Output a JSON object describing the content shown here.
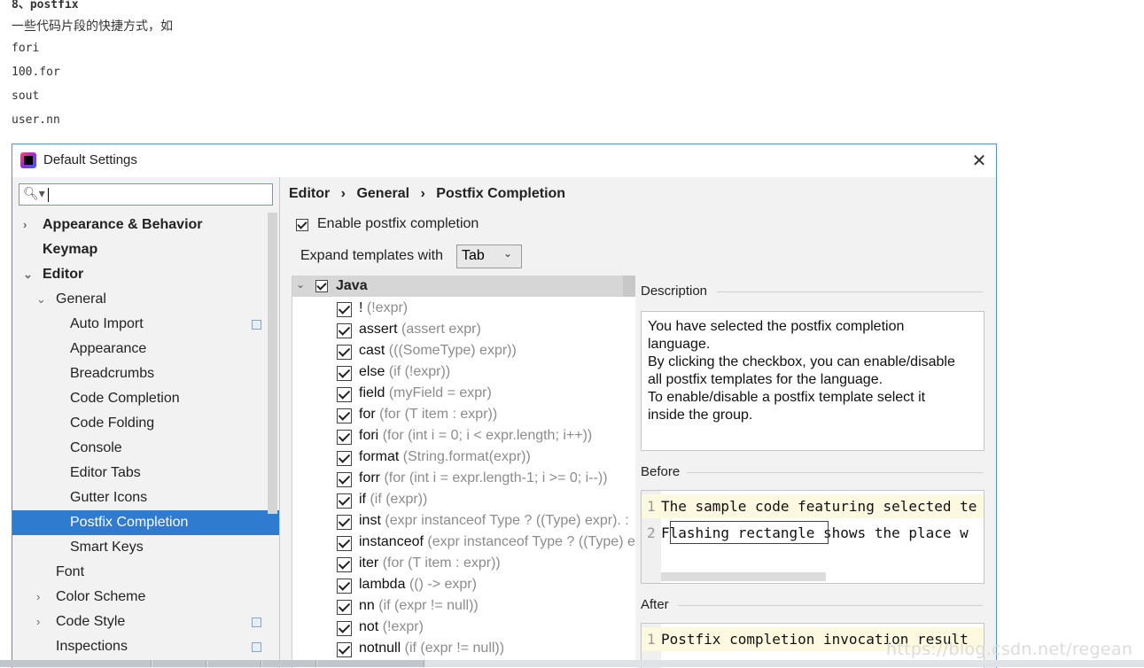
{
  "blog": {
    "heading": "8、postfix",
    "line1": "一些代码片段的快捷方式，如",
    "line2": "fori",
    "line3": "100.for",
    "line4": "sout",
    "line5": "user.nn"
  },
  "window": {
    "title": "Default Settings",
    "close_icon": "close-icon"
  },
  "sidebar": {
    "search_value": "",
    "items": [
      {
        "label": "Appearance & Behavior",
        "level": 0,
        "bold": true,
        "arrow": "›"
      },
      {
        "label": "Keymap",
        "level": 0,
        "bold": true,
        "arrow": ""
      },
      {
        "label": "Editor",
        "level": 0,
        "bold": true,
        "arrow": "⌄"
      },
      {
        "label": "General",
        "level": 1,
        "bold": false,
        "arrow": "⌄"
      },
      {
        "label": "Auto Import",
        "level": 2,
        "bold": false,
        "arrow": "",
        "cfg": true
      },
      {
        "label": "Appearance",
        "level": 2,
        "bold": false,
        "arrow": ""
      },
      {
        "label": "Breadcrumbs",
        "level": 2,
        "bold": false,
        "arrow": ""
      },
      {
        "label": "Code Completion",
        "level": 2,
        "bold": false,
        "arrow": ""
      },
      {
        "label": "Code Folding",
        "level": 2,
        "bold": false,
        "arrow": ""
      },
      {
        "label": "Console",
        "level": 2,
        "bold": false,
        "arrow": ""
      },
      {
        "label": "Editor Tabs",
        "level": 2,
        "bold": false,
        "arrow": ""
      },
      {
        "label": "Gutter Icons",
        "level": 2,
        "bold": false,
        "arrow": ""
      },
      {
        "label": "Postfix Completion",
        "level": 2,
        "bold": false,
        "arrow": "",
        "selected": true
      },
      {
        "label": "Smart Keys",
        "level": 2,
        "bold": false,
        "arrow": ""
      },
      {
        "label": "Font",
        "level": 1,
        "bold": false,
        "arrow": ""
      },
      {
        "label": "Color Scheme",
        "level": 1,
        "bold": false,
        "arrow": "›"
      },
      {
        "label": "Code Style",
        "level": 1,
        "bold": false,
        "arrow": "›",
        "cfg": true
      },
      {
        "label": "Inspections",
        "level": 1,
        "bold": false,
        "arrow": "",
        "cfg": true
      }
    ]
  },
  "breadcrumb": {
    "a": "Editor",
    "sep1": "›",
    "b": "General",
    "sep2": "›",
    "c": "Postfix Completion"
  },
  "options": {
    "enable_label": "Enable postfix completion",
    "expand_label": "Expand templates with",
    "expand_value": "Tab"
  },
  "templates": {
    "group": "Java",
    "items": [
      {
        "key": "!",
        "expr": "(!expr)"
      },
      {
        "key": "assert",
        "expr": "(assert expr)"
      },
      {
        "key": "cast",
        "expr": "(((SomeType) expr))"
      },
      {
        "key": "else",
        "expr": "(if (!expr))"
      },
      {
        "key": "field",
        "expr": "(myField = expr)"
      },
      {
        "key": "for",
        "expr": "(for (T item : expr))"
      },
      {
        "key": "fori",
        "expr": "(for (int i = 0; i < expr.length; i++))"
      },
      {
        "key": "format",
        "expr": "(String.format(expr))"
      },
      {
        "key": "forr",
        "expr": "(for (int i = expr.length-1; i >= 0; i--))"
      },
      {
        "key": "if",
        "expr": "(if (expr))"
      },
      {
        "key": "inst",
        "expr": "(expr instanceof Type ? ((Type) expr). :"
      },
      {
        "key": "instanceof",
        "expr": "(expr instanceof Type ? ((Type) e"
      },
      {
        "key": "iter",
        "expr": "(for (T item : expr))"
      },
      {
        "key": "lambda",
        "expr": "(() -> expr)"
      },
      {
        "key": "nn",
        "expr": "(if (expr != null))"
      },
      {
        "key": "not",
        "expr": "(!expr)"
      },
      {
        "key": "notnull",
        "expr": "(if (expr != null))"
      }
    ]
  },
  "description": {
    "label": "Description",
    "text1": "You have selected the postfix completion",
    "text2": "language.",
    "text3": "By clicking the checkbox, you can enable/disable",
    "text4": "all postfix templates for the language.",
    "text5": "To enable/disable a postfix template select it",
    "text6": "inside the group."
  },
  "before": {
    "label": "Before",
    "line1_num": "1",
    "line1": "The sample code featuring selected te",
    "line2_num": "2",
    "line2": "Flashing rectangle shows the place w"
  },
  "after": {
    "label": "After",
    "line1_num": "1",
    "line1": "Postfix completion invocation result"
  },
  "watermark": "https://blog.csdn.net/regean"
}
